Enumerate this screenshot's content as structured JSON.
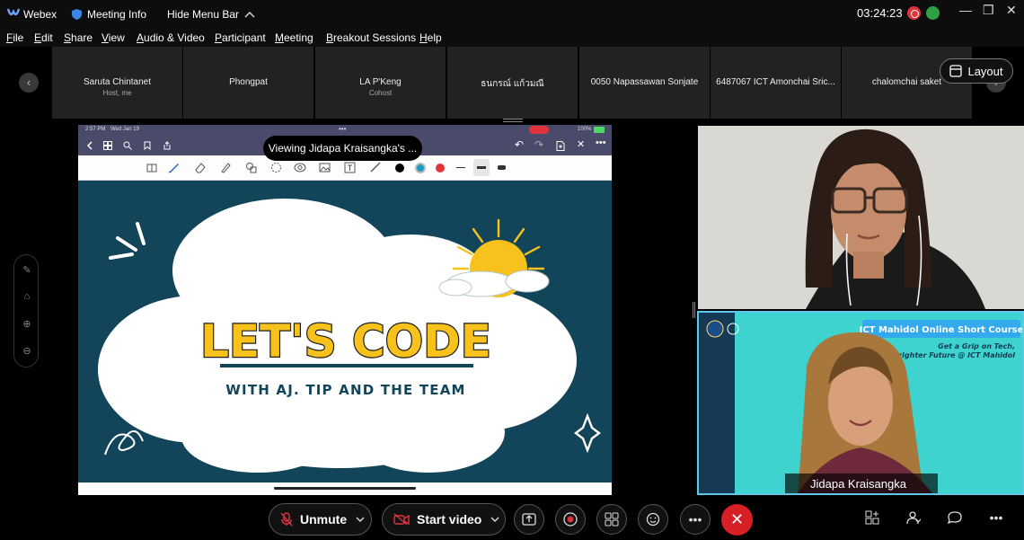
{
  "titlebar": {
    "app_name": "Webex",
    "meeting_info": "Meeting Info",
    "hide_menu": "Hide Menu Bar",
    "timer": "03:24:23"
  },
  "menu": [
    "File",
    "Edit",
    "Share",
    "View",
    "Audio & Video",
    "Participant",
    "Meeting",
    "Breakout Sessions",
    "Help"
  ],
  "participants": [
    {
      "name": "Saruta Chintanet",
      "role": "Host, me"
    },
    {
      "name": "Phongpat",
      "role": ""
    },
    {
      "name": "LA P'Keng",
      "role": "Cohost"
    },
    {
      "name": "ธนกรณ์ แก้วมณี",
      "role": ""
    },
    {
      "name": "0050 Napassawan Sonjate",
      "role": ""
    },
    {
      "name": "6487067 ICT Amonchai Sric...",
      "role": ""
    },
    {
      "name": "chalomchai saket",
      "role": ""
    }
  ],
  "layout_label": "Layout",
  "share": {
    "viewing_label": "Viewing Jidapa Kraisangka's ...",
    "status_time": "2:57 PM",
    "status_date": "Wed Jan 19",
    "status_battery": "100%",
    "slide_title": "LET'S CODE",
    "slide_subtitle": "WITH AJ. TIP AND THE TEAM"
  },
  "video": {
    "speaker_name": "Jidapa Kraisangka",
    "banner_title": "ICT Mahidol Online Short Course",
    "banner_line1": "Get a Grip on Tech,",
    "banner_line2": "t a Brighter Future @ ICT Mahidol"
  },
  "controls": {
    "unmute": "Unmute",
    "start_video": "Start video"
  },
  "colors": {
    "accent_red": "#d81f26",
    "slide_bg": "#12455a",
    "sun": "#f7c21b",
    "teal_bg": "#3fd3cf"
  }
}
